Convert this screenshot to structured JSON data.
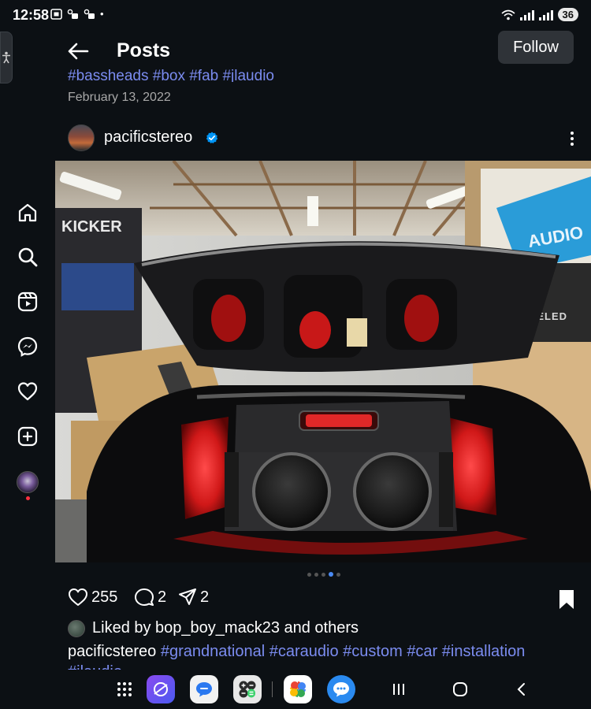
{
  "status_bar": {
    "time": "12:58",
    "battery": "36",
    "left_icons": [
      "screenshot-icon",
      "notification-icon",
      "notification-icon"
    ],
    "right_icons": [
      "wifi-icon",
      "signal-icon",
      "signal-icon"
    ]
  },
  "header": {
    "title": "Posts",
    "follow_label": "Follow"
  },
  "previous_post": {
    "caption": "#bassheads #box #fab #jlaudio",
    "date": "February 13, 2022"
  },
  "post": {
    "username": "pacificstereo",
    "verified": true,
    "image_alt": "",
    "carousel": {
      "count": 5,
      "active": 4
    },
    "likes": "255",
    "comments": "2",
    "shares": "2",
    "liked_by": "Liked by bop_boy_mack23 and others",
    "caption_user": "pacificstereo",
    "caption_tags": [
      "#grandnational",
      "#caraudio",
      "#custom",
      "#car",
      "#installation"
    ],
    "caption_next": "#jlaudio"
  },
  "nav": [
    "home-icon",
    "search-icon",
    "reels-icon",
    "messenger-icon",
    "heart-icon",
    "create-icon",
    "profile-avatar"
  ],
  "dock": {
    "apps": [
      "apps-grid-icon",
      "internet-app",
      "messages-app",
      "calculator-app",
      "photos-app",
      "chat-app"
    ],
    "nav_buttons": [
      "recents-button",
      "home-button",
      "back-button"
    ]
  },
  "colors": {
    "background": "#0c1014",
    "link": "#7b8cf0",
    "verified": "#0095f6"
  }
}
